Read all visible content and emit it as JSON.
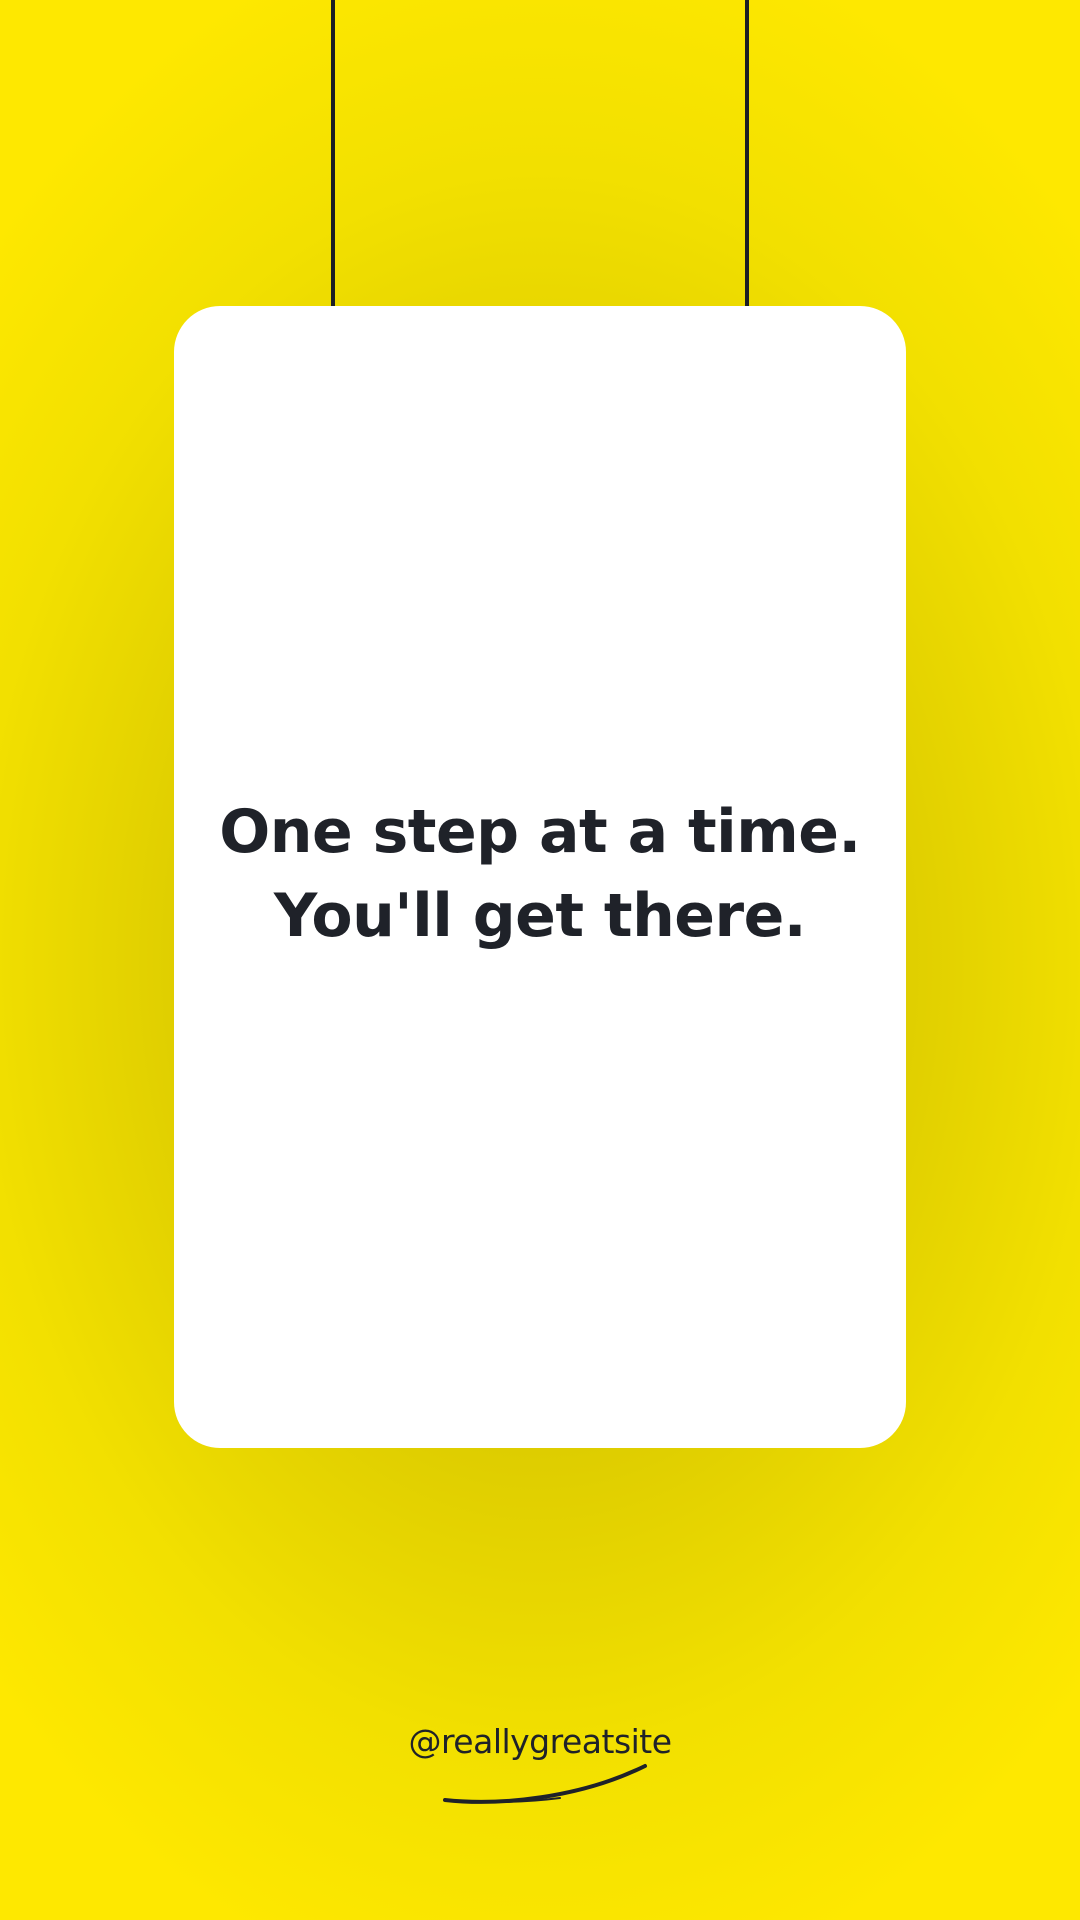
{
  "quote": {
    "line1": "One step at a time.",
    "line2": "You'll get there."
  },
  "footer": {
    "handle": "@reallygreatsite"
  },
  "colors": {
    "background": "#fee800",
    "card": "#ffffff",
    "text": "#1f2229",
    "string": "#1c1f24"
  }
}
